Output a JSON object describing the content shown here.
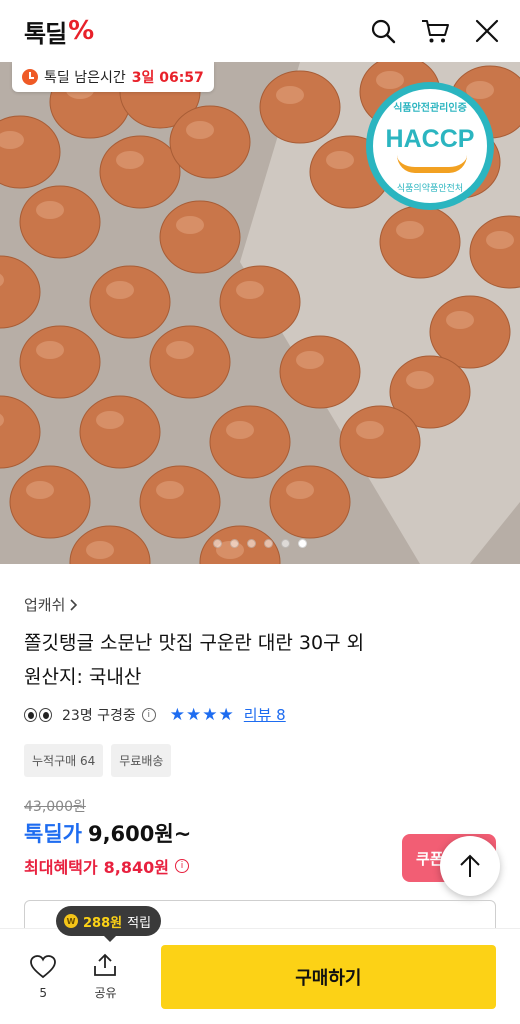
{
  "header": {
    "logo_text": "톡딜",
    "logo_mark": "%",
    "icons": [
      "search-icon",
      "cart-icon",
      "close-icon"
    ]
  },
  "hero": {
    "timer_label": "톡딜 남은시간",
    "timer_value": "3일 06:57",
    "badge": {
      "top_text": "식품안전관리인증",
      "main_text": "HACCP",
      "bottom_text": "식품의약품안전처"
    },
    "carousel": {
      "total": 6,
      "active": 6
    }
  },
  "product": {
    "seller": "업캐쉬",
    "title_line1": "쫄깃탱글 소문난 맛집 구운란 대란 30구 외",
    "title_line2": "원산지: 국내산",
    "viewers": "23명 구경중",
    "rating_stars": 4,
    "review_link": "리뷰 8",
    "chips": [
      "누적구매 64",
      "무료배송"
    ],
    "original_price": "43,000원",
    "deal_label": "톡딜가",
    "deal_price": "9,600원~",
    "max_label": "최대혜택가",
    "max_price": "8,840원",
    "coupon_label": "쿠폰"
  },
  "bottom_bar": {
    "like_count": "5",
    "share_label": "공유",
    "buy_label": "구매하기",
    "point_amount": "288원",
    "point_label": "적립"
  },
  "colors": {
    "brand_red": "#e8212a",
    "deal_blue": "#1e6cf0",
    "buy_yellow": "#fcd216",
    "max_red": "#e8213f"
  }
}
